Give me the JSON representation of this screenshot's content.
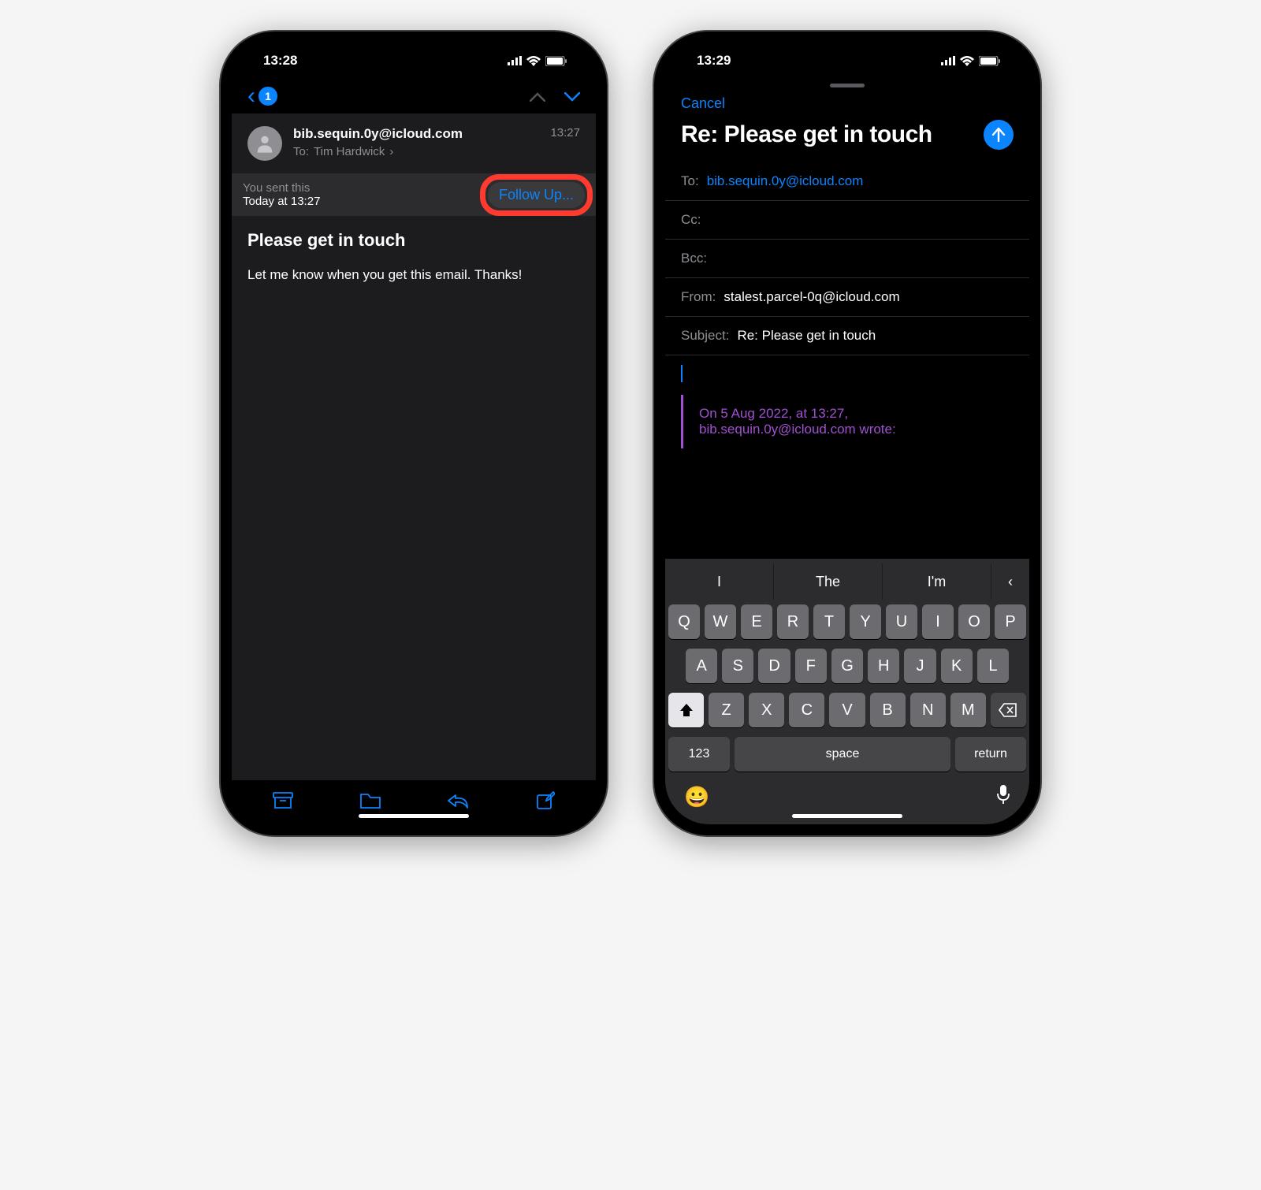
{
  "left": {
    "status_time": "13:28",
    "back_badge": "1",
    "header": {
      "from_addr": "bib.sequin.0y@icloud.com",
      "time": "13:27",
      "to_label": "To:",
      "to_name": "Tim Hardwick"
    },
    "banner": {
      "line1": "You sent this",
      "line2": "Today at 13:27",
      "followup": "Follow Up..."
    },
    "subject": "Please get in touch",
    "body": "Let me know when you get this email. Thanks!"
  },
  "right": {
    "status_time": "13:29",
    "cancel": "Cancel",
    "title": "Re: Please get in touch",
    "fields": {
      "to_label": "To:",
      "to_value": "bib.sequin.0y@icloud.com",
      "cc_label": "Cc:",
      "bcc_label": "Bcc:",
      "from_label": "From:",
      "from_value": "stalest.parcel-0q@icloud.com",
      "subject_label": "Subject:",
      "subject_value": "Re: Please get in touch"
    },
    "quote_line1": "On 5 Aug 2022, at 13:27,",
    "quote_line2": "bib.sequin.0y@icloud.com wrote:",
    "suggestions": [
      "I",
      "The",
      "I'm"
    ],
    "keyboard": {
      "row1": [
        "Q",
        "W",
        "E",
        "R",
        "T",
        "Y",
        "U",
        "I",
        "O",
        "P"
      ],
      "row2": [
        "A",
        "S",
        "D",
        "F",
        "G",
        "H",
        "J",
        "K",
        "L"
      ],
      "row3": [
        "Z",
        "X",
        "C",
        "V",
        "B",
        "N",
        "M"
      ],
      "fn_123": "123",
      "fn_space": "space",
      "fn_return": "return"
    }
  }
}
